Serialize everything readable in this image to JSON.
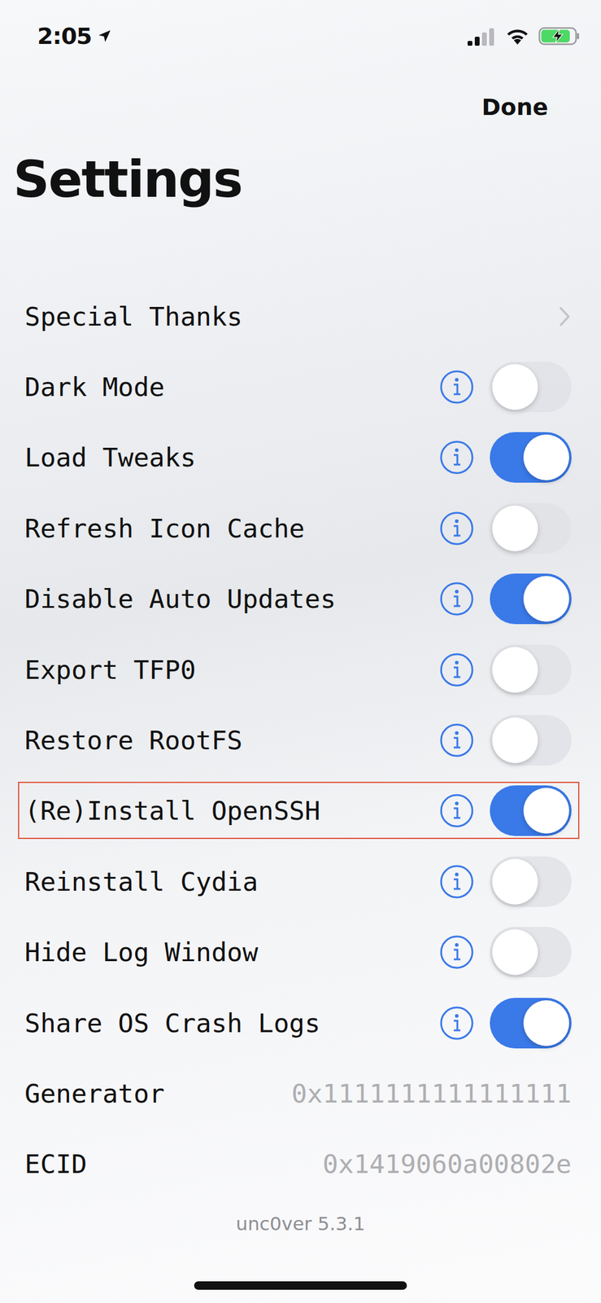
{
  "status_bar": {
    "time": "2:05",
    "location_active": true,
    "signal": {
      "level": 0.5
    },
    "wifi": true,
    "battery": {
      "level": 0.85,
      "charging": true
    }
  },
  "nav": {
    "done": "Done",
    "title": "Settings"
  },
  "rows": [
    {
      "label": "Special Thanks",
      "kind": "link",
      "highlighted": false
    },
    {
      "label": "Dark Mode",
      "kind": "toggle",
      "on": false,
      "highlighted": false
    },
    {
      "label": "Load Tweaks",
      "kind": "toggle",
      "on": true,
      "highlighted": false
    },
    {
      "label": "Refresh Icon Cache",
      "kind": "toggle",
      "on": false,
      "highlighted": false
    },
    {
      "label": "Disable Auto Updates",
      "kind": "toggle",
      "on": true,
      "highlighted": false
    },
    {
      "label": "Export TFP0",
      "kind": "toggle",
      "on": false,
      "highlighted": false
    },
    {
      "label": "Restore RootFS",
      "kind": "toggle",
      "on": false,
      "highlighted": false
    },
    {
      "label": "(Re)Install OpenSSH",
      "kind": "toggle",
      "on": true,
      "highlighted": true
    },
    {
      "label": "Reinstall Cydia",
      "kind": "toggle",
      "on": false,
      "highlighted": false
    },
    {
      "label": "Hide Log Window",
      "kind": "toggle",
      "on": false,
      "highlighted": false
    },
    {
      "label": "Share OS Crash Logs",
      "kind": "toggle",
      "on": true,
      "highlighted": false
    },
    {
      "label": "Generator",
      "kind": "value",
      "value": "0x1111111111111111",
      "highlighted": false
    },
    {
      "label": "ECID",
      "kind": "value",
      "value": "0x1419060a00802e",
      "highlighted": false
    }
  ],
  "footer": "unc0ver 5.3.1"
}
